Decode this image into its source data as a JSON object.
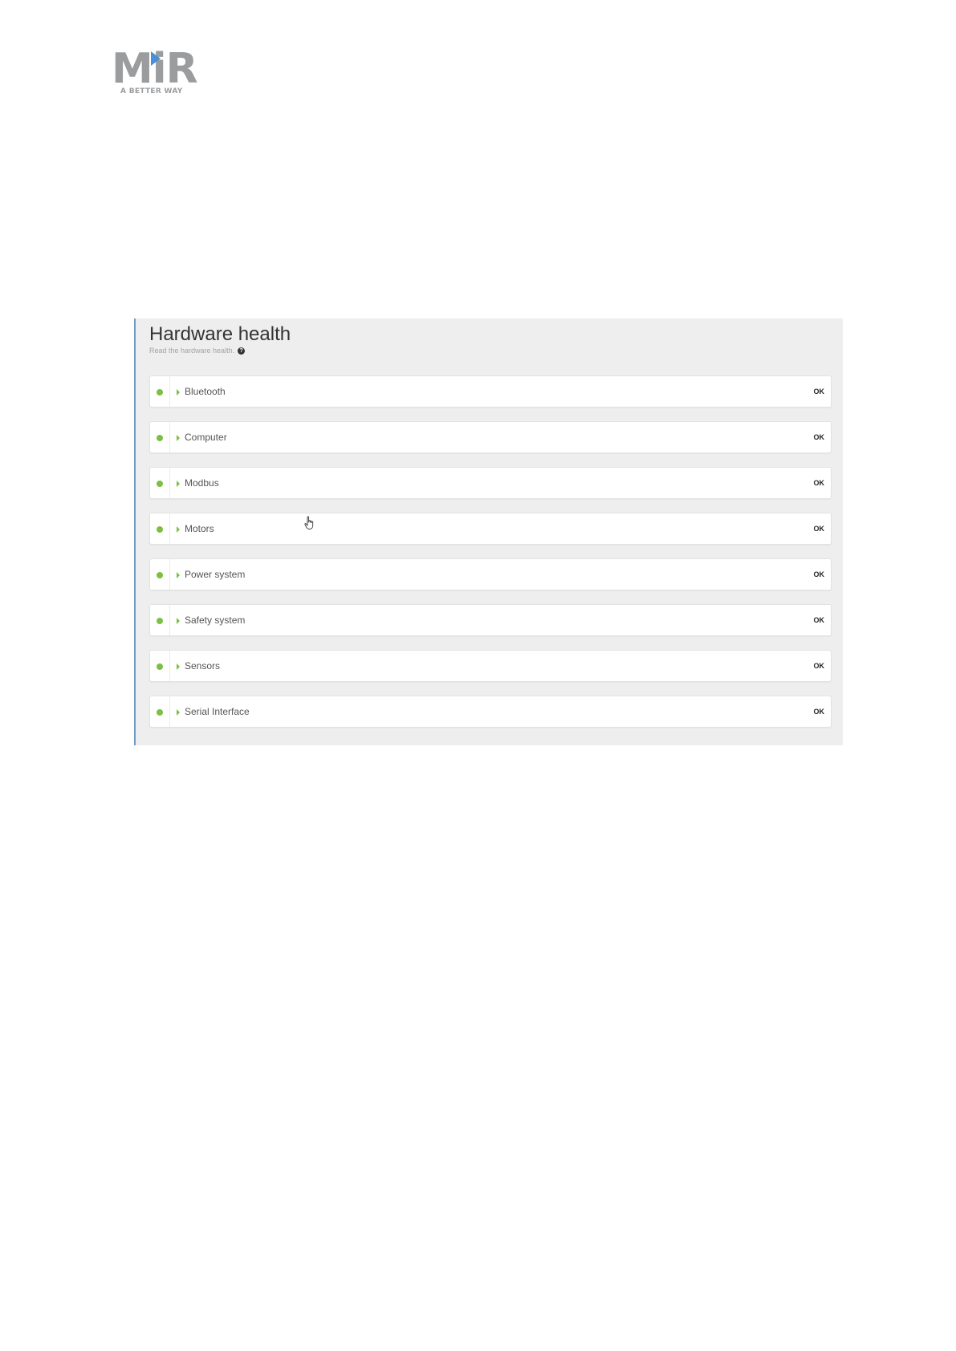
{
  "logo": {
    "wordmark": "MiR",
    "tagline": "A BETTER WAY",
    "accent_color": "#4a8fd8",
    "text_color": "#9a9c9e"
  },
  "panel": {
    "title": "Hardware health",
    "subtitle": "Read the hardware health.",
    "help_icon": "question-circle-icon",
    "status_color_ok": "#7cc043",
    "items": [
      {
        "label": "Bluetooth",
        "status": "OK"
      },
      {
        "label": "Computer",
        "status": "OK"
      },
      {
        "label": "Modbus",
        "status": "OK"
      },
      {
        "label": "Motors",
        "status": "OK"
      },
      {
        "label": "Power system",
        "status": "OK"
      },
      {
        "label": "Safety system",
        "status": "OK"
      },
      {
        "label": "Sensors",
        "status": "OK"
      },
      {
        "label": "Serial Interface",
        "status": "OK"
      }
    ]
  },
  "cursor": {
    "icon": "hand-pointer-icon"
  }
}
